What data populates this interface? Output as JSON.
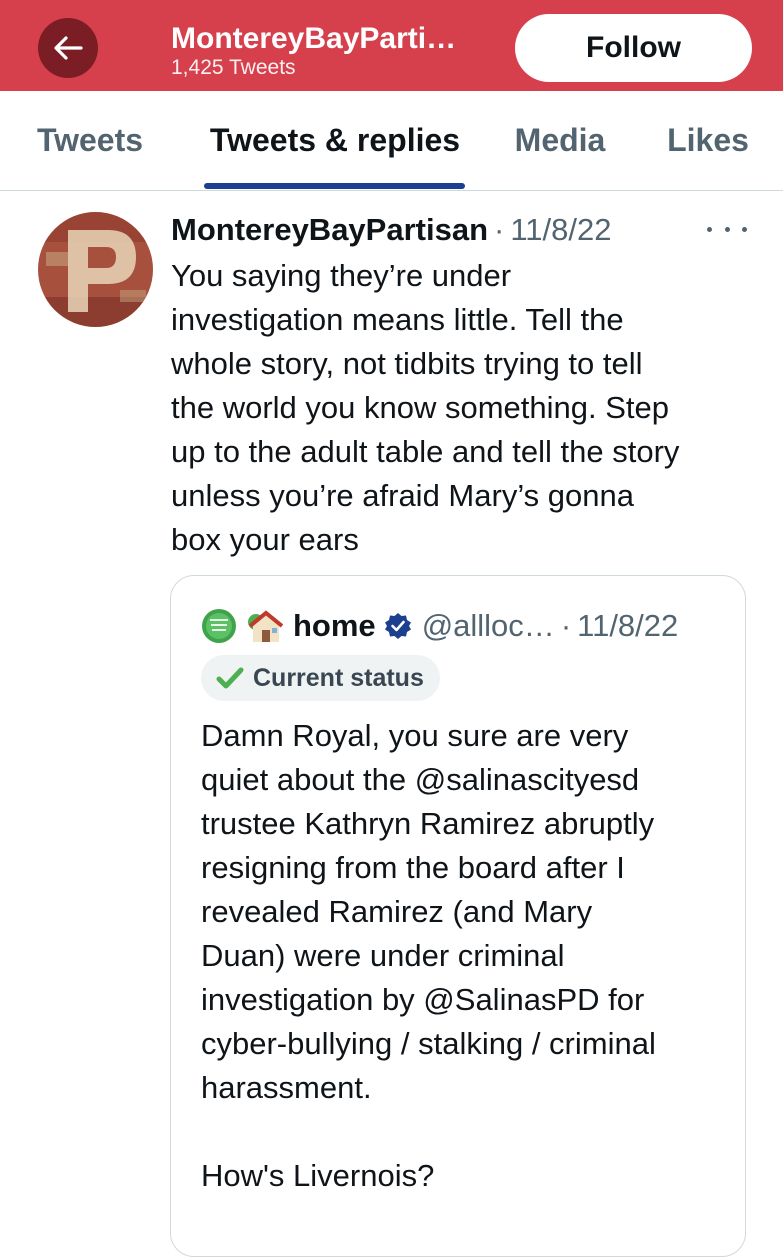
{
  "header": {
    "title": "MontereyBayParti…",
    "subtitle": "1,425 Tweets",
    "follow_label": "Follow"
  },
  "tabs": [
    {
      "label": "Tweets",
      "active": false
    },
    {
      "label": "Tweets & replies",
      "active": true
    },
    {
      "label": "Media",
      "active": false
    },
    {
      "label": "Likes",
      "active": false
    }
  ],
  "tweet": {
    "author": "MontereyBayPartisan",
    "separator": "·",
    "date": "11/8/22",
    "text": "You saying they’re under\ninvestigation means little. Tell the\nwhole story, not tidbits trying to tell\nthe world you know something. Step\nup to the adult table and tell the story\nunless you’re afraid Mary’s gonna\nbox your ears",
    "quote": {
      "name": "home",
      "handle": "@allloc…",
      "separator": "·",
      "date": "11/8/22",
      "status_label": "Current status",
      "text": "Damn Royal, you sure are very\nquiet about the @salinascityesd\ntrustee Kathryn Ramirez abruptly\nresigning from the board after I\nrevealed Ramirez (and Mary\nDuan) were under criminal\ninvestigation by @SalinasPD for\ncyber-bullying / stalking / criminal\nharassment.\n\nHow's  Livernois?"
    }
  },
  "icons": {
    "back": "back-arrow-icon",
    "more": "more-icon",
    "verified": "verified-icon",
    "check": "check-icon",
    "house": "house-emoji-icon",
    "keep_calm": "keep-calm-badge-icon"
  },
  "colors": {
    "header_bg": "#d5404c",
    "back_button": "#7a1d24",
    "tab_indicator": "#1d3f8f",
    "verified": "#1d3f8f",
    "check": "#4caf50"
  }
}
